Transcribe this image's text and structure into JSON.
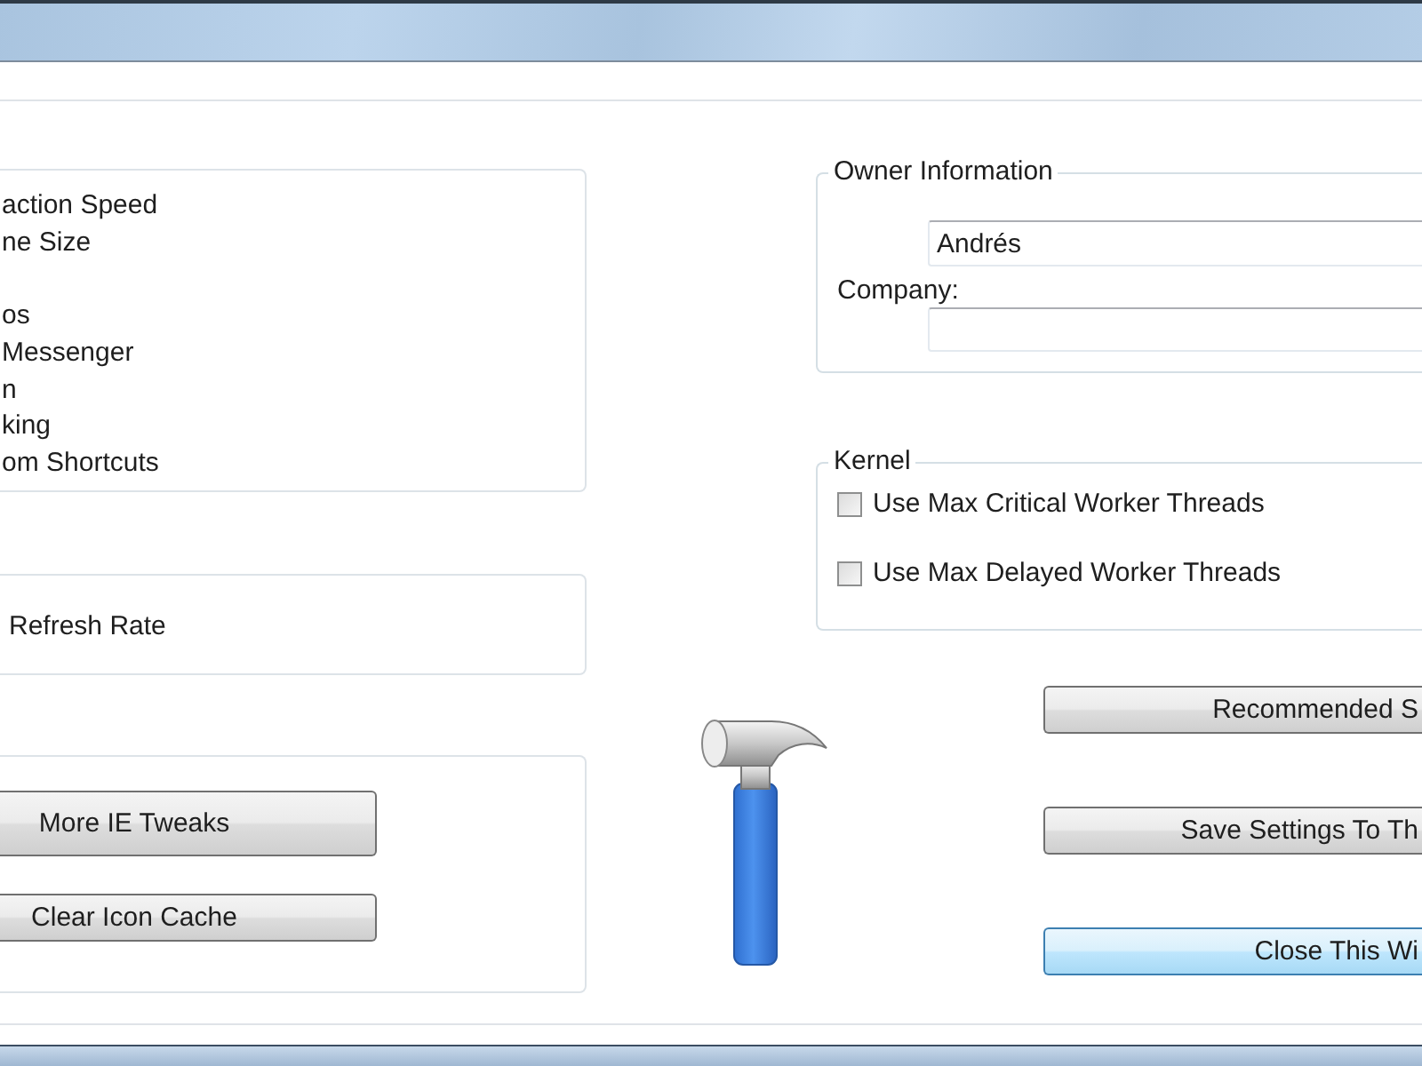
{
  "left_list": {
    "items": [
      "action Speed",
      "ne Size",
      "os",
      "Messenger",
      "n",
      "king",
      "om Shortcuts"
    ]
  },
  "refresh_panel": {
    "label": "Refresh Rate"
  },
  "tools_panel": {
    "buttons": [
      {
        "label": "More IE Tweaks"
      },
      {
        "label": "Clear Icon Cache"
      }
    ]
  },
  "owner_information": {
    "legend": "Owner Information",
    "fields": [
      {
        "value": "Andrés"
      },
      {
        "label": "Company:"
      }
    ]
  },
  "kernel": {
    "legend": "Kernel",
    "options": [
      {
        "label": "Use Max Critical Worker Threads",
        "checked": false
      },
      {
        "label": "Use Max Delayed Worker Threads",
        "checked": false
      }
    ]
  },
  "actions": [
    {
      "label": "Recommended S",
      "focused": false
    },
    {
      "label": "Save Settings To Th",
      "focused": false
    },
    {
      "label": "Close This Wi",
      "focused": true
    }
  ]
}
